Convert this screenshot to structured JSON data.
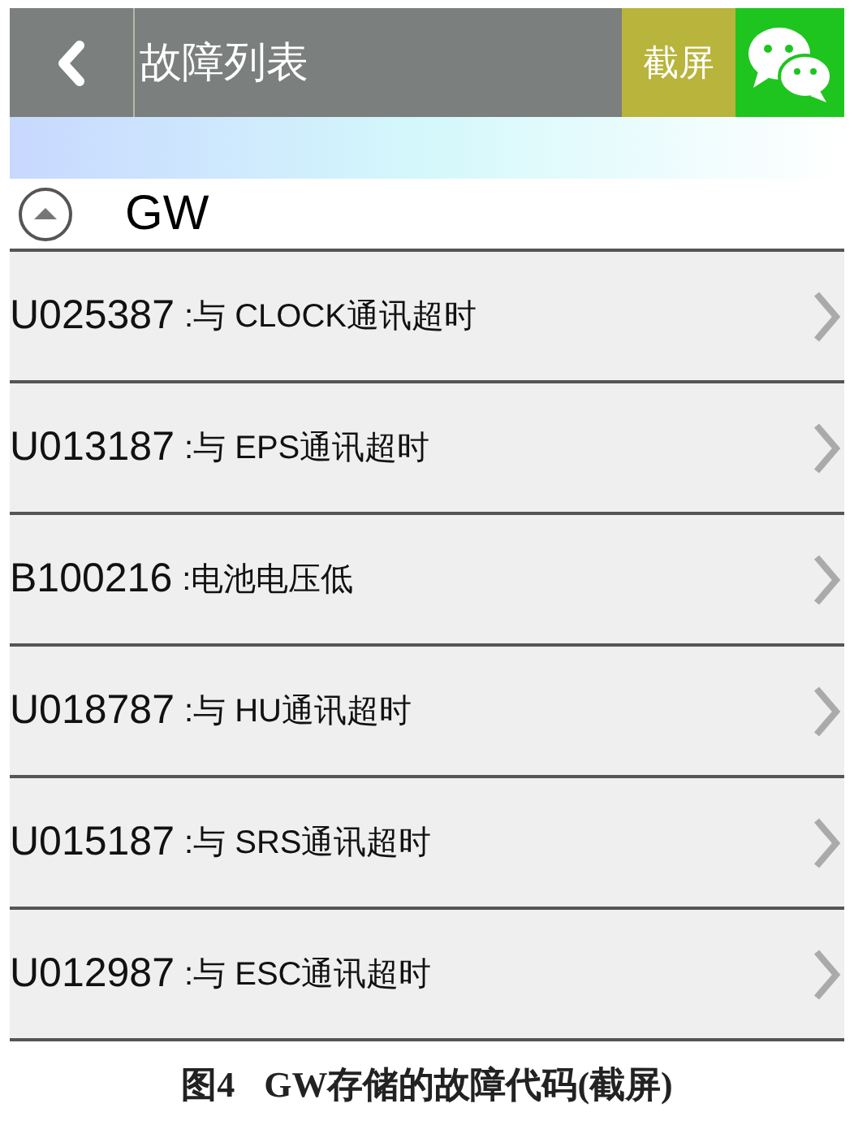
{
  "header": {
    "title": "故障列表",
    "screenshot_button": "截屏"
  },
  "group": {
    "name": "GW",
    "expanded": true,
    "faults": [
      {
        "code": "U025387",
        "description": ":与 CLOCK通讯超时"
      },
      {
        "code": "U013187",
        "description": ":与 EPS通讯超时"
      },
      {
        "code": "B100216",
        "description": ":电池电压低"
      },
      {
        "code": "U018787",
        "description": ":与 HU通讯超时"
      },
      {
        "code": "U015187",
        "description": ":与 SRS通讯超时"
      },
      {
        "code": "U012987",
        "description": ":与 ESC通讯超时"
      }
    ]
  },
  "caption": {
    "label": "图4",
    "text": "GW存储的故障代码(截屏)"
  }
}
